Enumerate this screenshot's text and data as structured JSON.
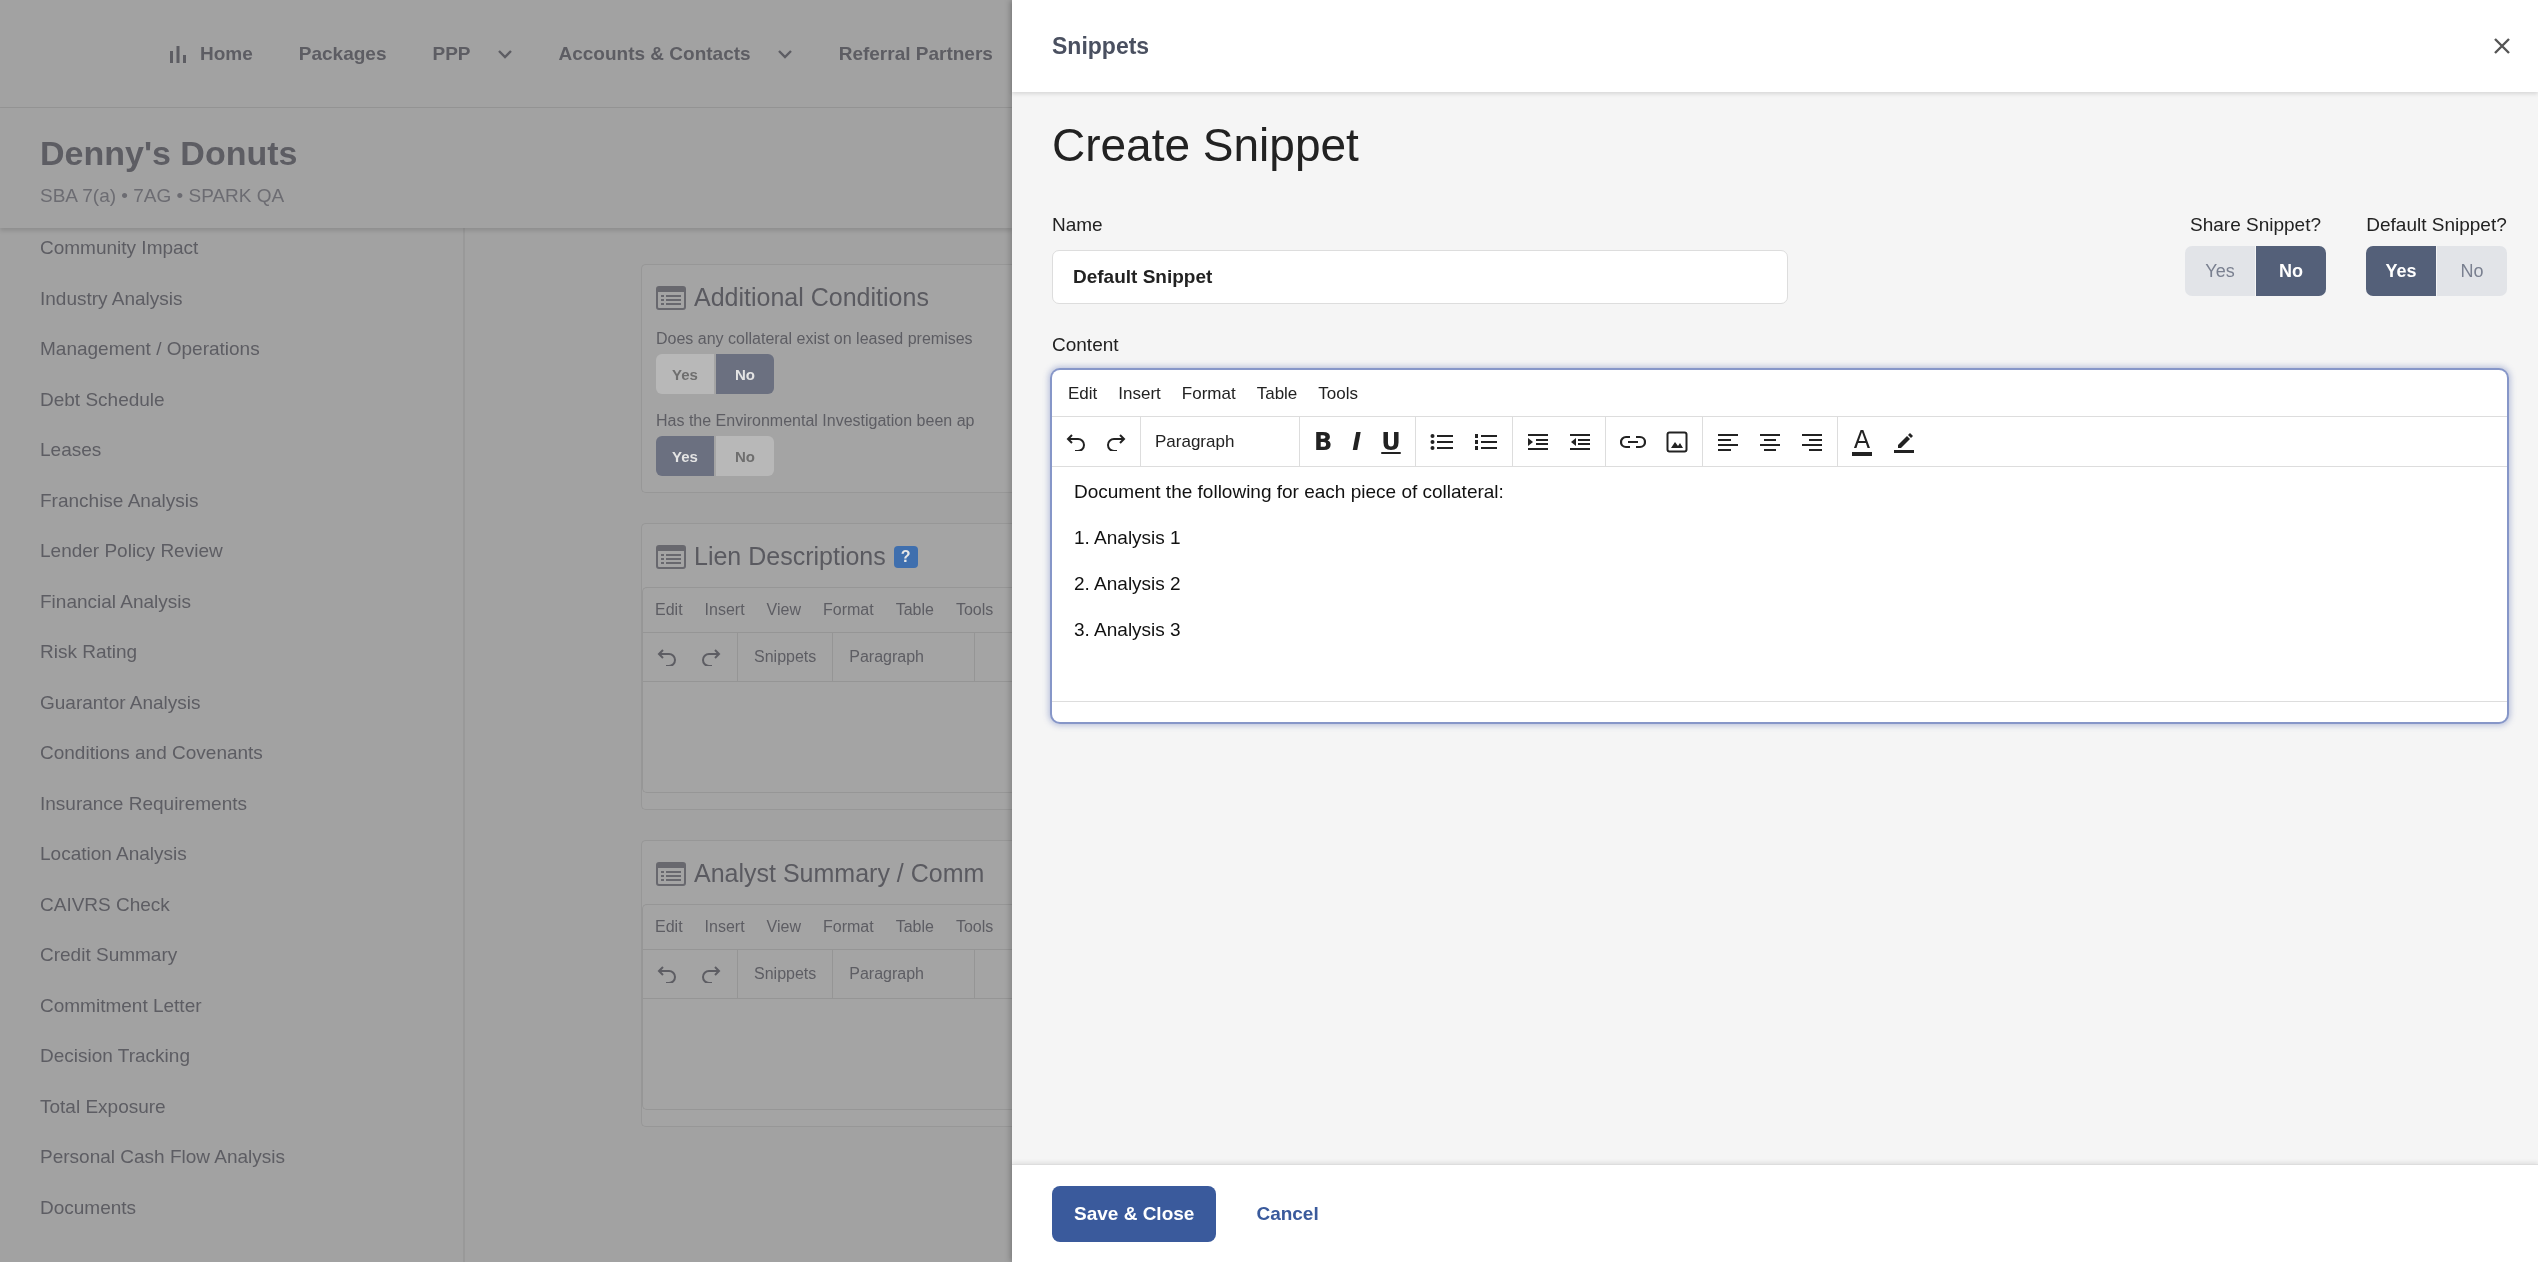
{
  "nav": {
    "items": [
      {
        "label": "Home",
        "has_icon": true,
        "dropdown": false
      },
      {
        "label": "Packages",
        "has_icon": false,
        "dropdown": false
      },
      {
        "label": "PPP",
        "has_icon": false,
        "dropdown": true
      },
      {
        "label": "Accounts & Contacts",
        "has_icon": false,
        "dropdown": true
      },
      {
        "label": "Referral Partners",
        "has_icon": false,
        "dropdown": false
      }
    ]
  },
  "page_header": {
    "title": "Denny's Donuts",
    "subtitle": "SBA 7(a) • 7AG • SPARK QA"
  },
  "sidebar": {
    "items": [
      "Community Impact",
      "Industry Analysis",
      "Management / Operations",
      "Debt Schedule",
      "Leases",
      "Franchise Analysis",
      "Lender Policy Review",
      "Financial Analysis",
      "Risk Rating",
      "Guarantor Analysis",
      "Conditions and Covenants",
      "Insurance Requirements",
      "Location Analysis",
      "CAIVRS Check",
      "Credit Summary",
      "Commitment Letter",
      "Decision Tracking",
      "Total Exposure",
      "Personal Cash Flow Analysis",
      "Documents"
    ]
  },
  "sections": [
    {
      "kind": "questions",
      "title": "Additional Conditions",
      "questions": [
        {
          "text": "Does any collateral exist on leased premises",
          "options": [
            {
              "label": "Yes",
              "selected": false
            },
            {
              "label": "No",
              "selected": true
            }
          ]
        },
        {
          "text": "Has the Environmental Investigation been ap",
          "options": [
            {
              "label": "Yes",
              "selected": true
            },
            {
              "label": "No",
              "selected": false
            }
          ]
        }
      ]
    },
    {
      "kind": "editor",
      "title": "Lien Descriptions",
      "help": "?",
      "menu": [
        "Edit",
        "Insert",
        "View",
        "Format",
        "Table",
        "Tools"
      ],
      "toolbar": [
        "Snippets",
        "Paragraph"
      ]
    },
    {
      "kind": "editor",
      "title": "Analyst Summary / Comm",
      "menu": [
        "Edit",
        "Insert",
        "View",
        "Format",
        "Table",
        "Tools"
      ],
      "toolbar": [
        "Snippets",
        "Paragraph"
      ]
    }
  ],
  "panel": {
    "title": "Snippets",
    "heading": "Create Snippet",
    "name_field": {
      "label": "Name",
      "value": "Default Snippet"
    },
    "toggles": [
      {
        "label": "Share Snippet?",
        "options": [
          {
            "label": "Yes",
            "selected": false
          },
          {
            "label": "No",
            "selected": true
          }
        ]
      },
      {
        "label": "Default Snippet?",
        "options": [
          {
            "label": "Yes",
            "selected": true
          },
          {
            "label": "No",
            "selected": false
          }
        ]
      }
    ],
    "content": {
      "label": "Content",
      "menu": [
        "Edit",
        "Insert",
        "Format",
        "Table",
        "Tools"
      ],
      "block_format": "Paragraph",
      "format_buttons": [
        "B",
        "I",
        "U"
      ],
      "text_color_glyph": "A",
      "paragraphs": [
        "Document the following for each piece of collateral:",
        "1. Analysis 1",
        "2. Analysis 2",
        "3. Analysis 3"
      ]
    },
    "buttons": {
      "primary": "Save & Close",
      "secondary": "Cancel"
    }
  }
}
